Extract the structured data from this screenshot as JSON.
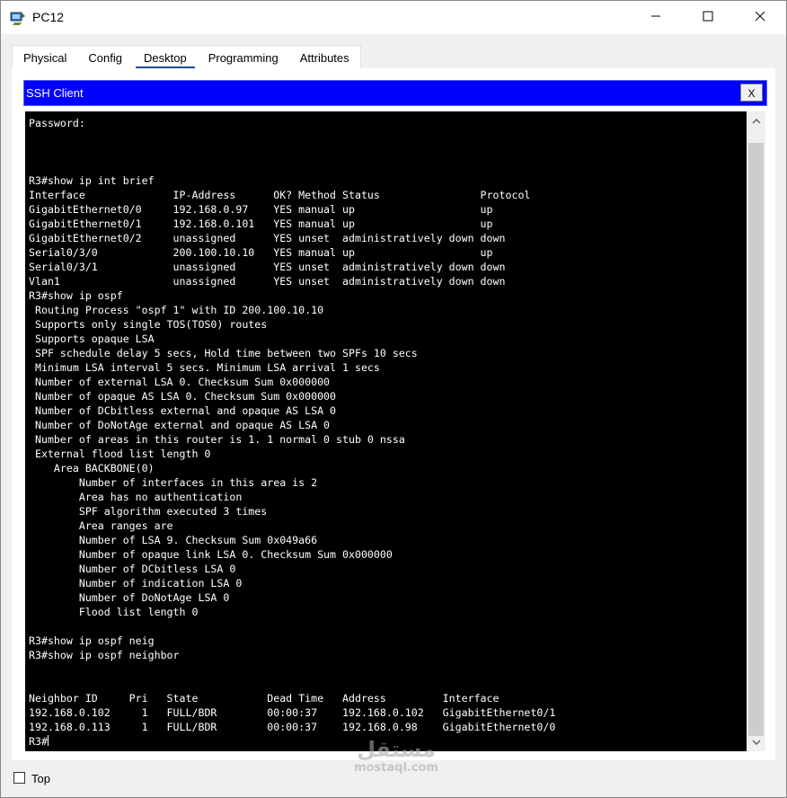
{
  "window": {
    "title": "PC12",
    "minimize_icon": "minimize-icon",
    "maximize_icon": "maximize-icon",
    "close_icon": "close-icon"
  },
  "tabs": [
    {
      "label": "Physical",
      "active": false
    },
    {
      "label": "Config",
      "active": false
    },
    {
      "label": "Desktop",
      "active": true
    },
    {
      "label": "Programming",
      "active": false
    },
    {
      "label": "Attributes",
      "active": false
    }
  ],
  "ssh": {
    "title": "SSH Client",
    "close_label": "X"
  },
  "terminal": {
    "lines": [
      "Password:",
      "",
      "",
      "",
      "R3#show ip int brief",
      "Interface              IP-Address      OK? Method Status                Protocol",
      "GigabitEthernet0/0     192.168.0.97    YES manual up                    up",
      "GigabitEthernet0/1     192.168.0.101   YES manual up                    up",
      "GigabitEthernet0/2     unassigned      YES unset  administratively down down",
      "Serial0/3/0            200.100.10.10   YES manual up                    up",
      "Serial0/3/1            unassigned      YES unset  administratively down down",
      "Vlan1                  unassigned      YES unset  administratively down down",
      "R3#show ip ospf",
      " Routing Process \"ospf 1\" with ID 200.100.10.10",
      " Supports only single TOS(TOS0) routes",
      " Supports opaque LSA",
      " SPF schedule delay 5 secs, Hold time between two SPFs 10 secs",
      " Minimum LSA interval 5 secs. Minimum LSA arrival 1 secs",
      " Number of external LSA 0. Checksum Sum 0x000000",
      " Number of opaque AS LSA 0. Checksum Sum 0x000000",
      " Number of DCbitless external and opaque AS LSA 0",
      " Number of DoNotAge external and opaque AS LSA 0",
      " Number of areas in this router is 1. 1 normal 0 stub 0 nssa",
      " External flood list length 0",
      "    Area BACKBONE(0)",
      "        Number of interfaces in this area is 2",
      "        Area has no authentication",
      "        SPF algorithm executed 3 times",
      "        Area ranges are",
      "        Number of LSA 9. Checksum Sum 0x049a66",
      "        Number of opaque link LSA 0. Checksum Sum 0x000000",
      "        Number of DCbitless LSA 0",
      "        Number of indication LSA 0",
      "        Number of DoNotAge LSA 0",
      "        Flood list length 0",
      "",
      "R3#show ip ospf neig",
      "R3#show ip ospf neighbor",
      "",
      "",
      "Neighbor ID     Pri   State           Dead Time   Address         Interface",
      "192.168.0.102     1   FULL/BDR        00:00:37    192.168.0.102   GigabitEthernet0/1",
      "192.168.0.113     1   FULL/BDR        00:00:37    192.168.0.98    GigabitEthernet0/0",
      "R3#"
    ]
  },
  "footer": {
    "top_label": "Top",
    "top_checked": false
  },
  "watermark": {
    "arabic": "مستقل",
    "latin": "mostaql.com"
  },
  "colors": {
    "ssh_header": "#0000ff",
    "terminal_bg": "#000000",
    "terminal_fg": "#ffffff",
    "active_tab_underline": "#1f4e8c"
  }
}
